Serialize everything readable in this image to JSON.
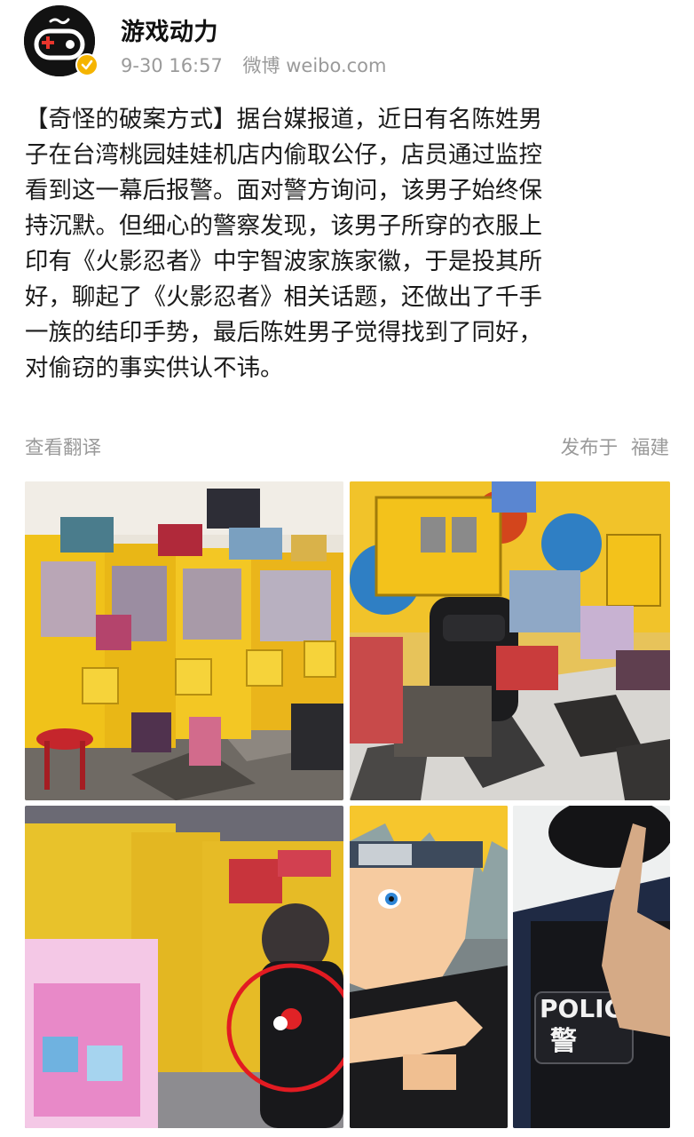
{
  "header": {
    "username": "游戏动力",
    "timestamp": "9-30 16:57",
    "source": "微博 weibo.com",
    "avatar_icon": "gamepad-logo-icon",
    "verified_badge": "verified-badge-icon",
    "colors": {
      "avatar_bg": "#121212",
      "avatar_accent": "#e8352c",
      "verified": "#f5b400",
      "meta_text": "#9a9a9a"
    }
  },
  "post": {
    "lines": [
      "【奇怪的破案方式】据台媒报道，近日有名陈姓男",
      "子在台湾桃园娃娃机店内偷取公仔，店员通过监控",
      "看到这一幕后报警。面对警方询问，该男子始终保",
      "持沉默。但细心的警察发现，该男子所穿的衣服上",
      "印有《火影忍者》中宇智波家族家徽，于是投其所",
      "好，聊起了《火影忍者》相关话题，还做出了千手",
      "一族的结印手势，最后陈姓男子觉得找到了同好，",
      "对偷窃的事实供认不讳。"
    ]
  },
  "actions": {
    "translate": "查看翻译",
    "location_prefix": "发布于",
    "location": "福建"
  },
  "photos": [
    {
      "id": "photo-claw-machines-shop",
      "name": "claw-machine-store-photo"
    },
    {
      "id": "photo-bags-on-floor",
      "name": "bags-and-boxes-photo"
    },
    {
      "id": "photo-cctv-suspect",
      "name": "cctv-suspect-photo"
    },
    {
      "id": "photo-naruto-sign",
      "name": "naruto-hand-sign-photo"
    },
    {
      "id": "photo-police-officer",
      "name": "police-officer-photo"
    }
  ],
  "photo_labels": {
    "police_patch_text": "POLIC",
    "police_patch_char": "警"
  }
}
